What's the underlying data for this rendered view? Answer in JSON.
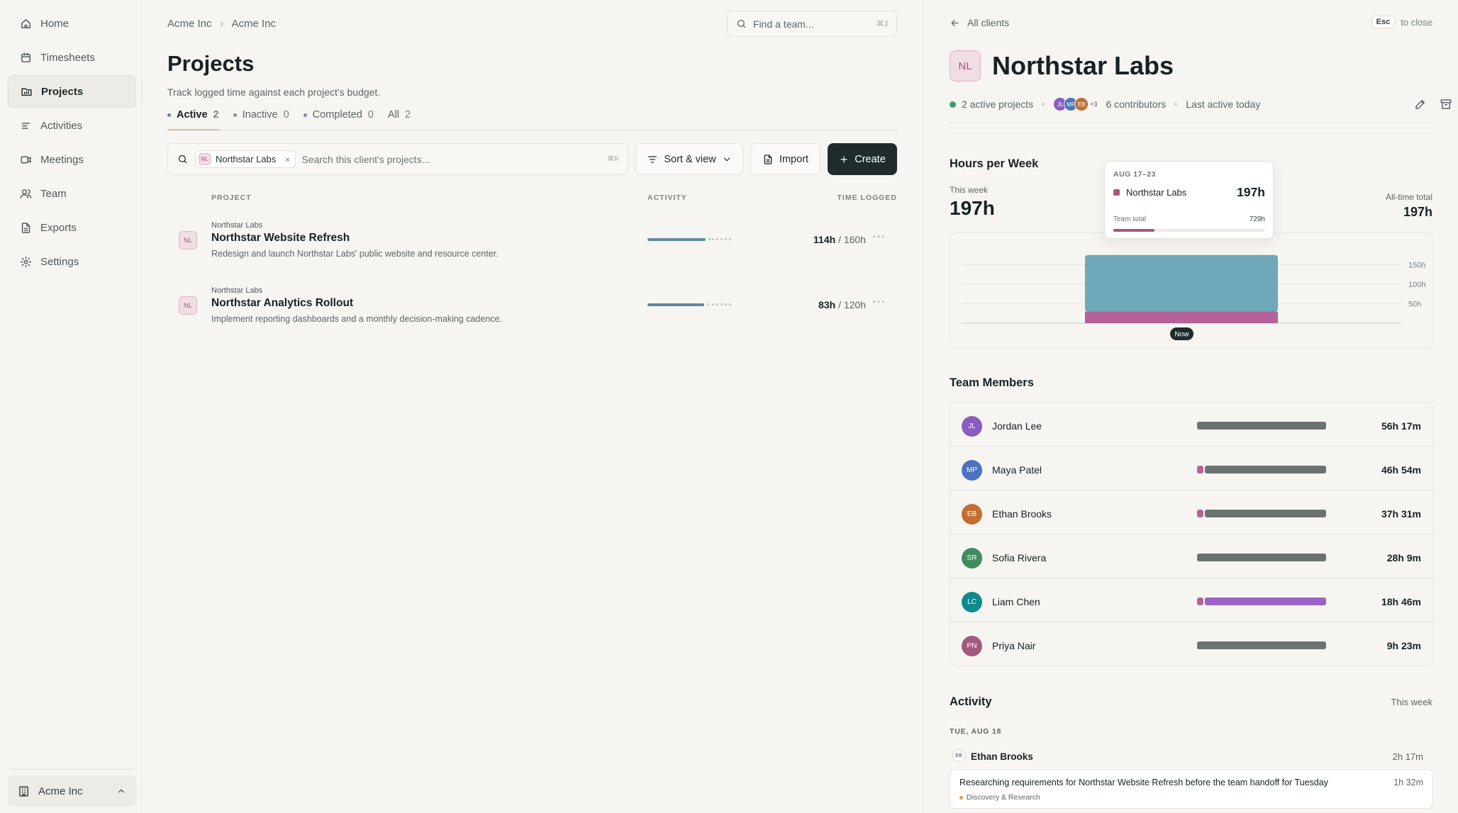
{
  "sidebar": {
    "items": [
      {
        "label": "Home",
        "icon": "home-icon"
      },
      {
        "label": "Timesheets",
        "icon": "calendar-icon"
      },
      {
        "label": "Projects",
        "icon": "folder-icon"
      },
      {
        "label": "Activities",
        "icon": "list-icon"
      },
      {
        "label": "Meetings",
        "icon": "video-icon"
      },
      {
        "label": "Team",
        "icon": "users-icon"
      },
      {
        "label": "Exports",
        "icon": "file-icon"
      },
      {
        "label": "Settings",
        "icon": "gear-icon"
      }
    ],
    "active": "Projects",
    "org": {
      "label": "Acme Inc"
    }
  },
  "header": {
    "breadcrumb": [
      "Acme Inc",
      "Acme Inc"
    ],
    "find_team": {
      "placeholder": "Find a team...",
      "shortcut": "⌘J"
    }
  },
  "projects": {
    "title": "Projects",
    "subtitle": "Track logged time against each project's budget.",
    "tabs": [
      {
        "label": "Active",
        "count": "2",
        "dot": "#5f8b9c",
        "active": true
      },
      {
        "label": "Inactive",
        "count": "0",
        "dot": "#8b9091"
      },
      {
        "label": "Completed",
        "count": "0",
        "dot": "#8f7fb8"
      },
      {
        "label": "All",
        "count": "2"
      }
    ],
    "filter_chip": {
      "initials": "NL",
      "label": "Northstar Labs",
      "close": "×"
    },
    "search_placeholder": "Search this client's projects...",
    "search_shortcut": "⌘K",
    "sort_label": "Sort & view",
    "import_label": "Import",
    "create_label": "Create",
    "columns": {
      "project": "PROJECT",
      "activity": "ACTIVITY",
      "time": "TIME LOGGED"
    },
    "rows": [
      {
        "initials": "NL",
        "client": "Northstar Labs",
        "name": "Northstar Website Refresh",
        "desc": "Redesign and launch Northstar Labs' public website and resource center.",
        "logged": "114h",
        "budget": "/ 160h",
        "progress": 0.7125
      },
      {
        "initials": "NL",
        "client": "Northstar Labs",
        "name": "Northstar Analytics Rollout",
        "desc": "Implement reporting dashboards and a monthly decision-making cadence.",
        "logged": "83h",
        "budget": "/ 120h",
        "progress": 0.6917
      }
    ]
  },
  "detail": {
    "back_label": "All clients",
    "esc_key": "Esc",
    "esc_text": "to close",
    "initials": "NL",
    "name": "Northstar Labs",
    "active_projects": "2 active projects",
    "avatars": [
      {
        "initials": "JL",
        "color": "#8a5cc0"
      },
      {
        "initials": "MP",
        "color": "#4b73c2"
      },
      {
        "initials": "EB",
        "color": "#c16f31"
      }
    ],
    "avatar_more": "+3",
    "contributors": "6 contributors",
    "last_active": "Last active today",
    "hours_title": "Hours per Week",
    "this_week_label": "This week",
    "this_week_value": "197h",
    "alltime_label": "All-time total",
    "alltime_value": "197h",
    "tooltip": {
      "date": "AUG 17–23",
      "client": "Northstar Labs",
      "value": "197h",
      "team_label": "Team total",
      "team_value": "729h",
      "share": 0.27
    },
    "team_title": "Team Members",
    "members": [
      {
        "initials": "JL",
        "name": "Jordan Lee",
        "time": "56h 17m",
        "color": "#8a5cc0",
        "bar": [
          {
            "c": "#6b7272",
            "w": 1.0
          }
        ]
      },
      {
        "initials": "MP",
        "name": "Maya Patel",
        "time": "46h 54m",
        "color": "#4b73c2",
        "bar": [
          {
            "c": "#b5619a",
            "w": 0.06
          },
          {
            "c": "#6b7272",
            "w": 0.94
          }
        ]
      },
      {
        "initials": "EB",
        "name": "Ethan Brooks",
        "time": "37h 31m",
        "color": "#c16f31",
        "bar": [
          {
            "c": "#b5619a",
            "w": 0.06
          },
          {
            "c": "#6b7272",
            "w": 0.94
          }
        ]
      },
      {
        "initials": "SR",
        "name": "Sofia Rivera",
        "time": "28h 9m",
        "color": "#3f8c5f",
        "bar": [
          {
            "c": "#6b7272",
            "w": 1.0
          }
        ]
      },
      {
        "initials": "LC",
        "name": "Liam Chen",
        "time": "18h 46m",
        "color": "#0d8b8f",
        "bar": [
          {
            "c": "#b5619a",
            "w": 0.06
          },
          {
            "c": "#9a63c4",
            "w": 0.94
          }
        ]
      },
      {
        "initials": "PN",
        "name": "Priya Nair",
        "time": "9h 23m",
        "color": "#a2587f",
        "bar": [
          {
            "c": "#6b7272",
            "w": 1.0
          }
        ]
      }
    ],
    "activity_title": "Activity",
    "activity_period": "This week",
    "day_label": "TUE, AUG 18",
    "entry_person": {
      "initials": "EB",
      "name": "Ethan Brooks",
      "time": "2h 17m"
    },
    "entry": {
      "text": "Researching requirements for Northstar Website Refresh before the team handoff for Tuesday",
      "time": "1h 32m",
      "tag": "Discovery & Research"
    }
  },
  "chart_data": {
    "type": "bar",
    "stacked": true,
    "categories": [
      "Now"
    ],
    "series": [
      {
        "values": [
          145
        ],
        "color": "#6fa8b8"
      },
      {
        "values": [
          30
        ],
        "color": "#b5619a"
      }
    ],
    "ytick_labels": [
      "50h",
      "100h",
      "150h"
    ],
    "ylim": [
      0,
      200
    ],
    "grid": true
  }
}
